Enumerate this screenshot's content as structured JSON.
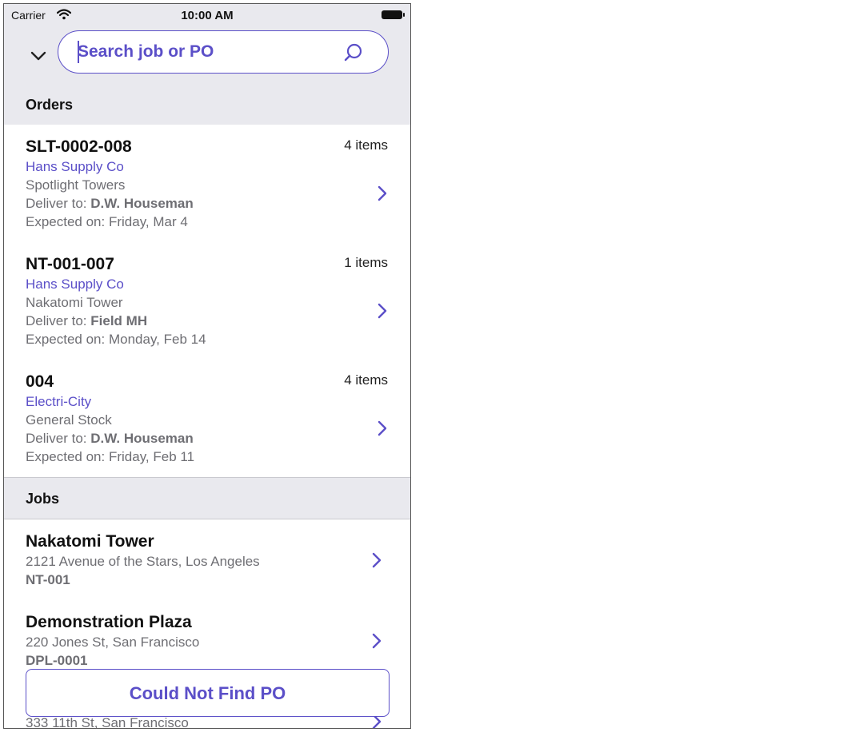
{
  "status_bar": {
    "carrier": "Carrier",
    "time": "10:00 AM"
  },
  "search": {
    "placeholder": "Search job or PO"
  },
  "sections": {
    "orders": "Orders",
    "jobs": "Jobs"
  },
  "orders": [
    {
      "po": "SLT-0002-008",
      "count": "4 items",
      "supplier": "Hans Supply Co",
      "place": "Spotlight Towers",
      "deliver_label": "Deliver to:",
      "deliver_to": "D.W. Houseman",
      "expected": "Expected on: Friday, Mar 4"
    },
    {
      "po": "NT-001-007",
      "count": "1 items",
      "supplier": "Hans Supply Co",
      "place": "Nakatomi Tower",
      "deliver_label": "Deliver to:",
      "deliver_to": "Field MH",
      "expected": "Expected on: Monday, Feb 14"
    },
    {
      "po": "004",
      "count": "4 items",
      "supplier": "Electri-City",
      "place": "General Stock",
      "deliver_label": "Deliver to:",
      "deliver_to": "D.W. Houseman",
      "expected": "Expected on: Friday, Feb 11"
    }
  ],
  "jobs": [
    {
      "name": "Nakatomi Tower",
      "address": "2121 Avenue of the Stars, Los Angeles",
      "code": "NT-001"
    },
    {
      "name": "Demonstration Plaza",
      "address": "220 Jones St, San Francisco",
      "code": "DPL-0001"
    },
    {
      "name": "",
      "address": "333 11th St, San Francisco",
      "code": ""
    }
  ],
  "could_not_find": "Could Not Find PO",
  "colors": {
    "accent": "#5b4fc8",
    "secondary_text": "#6e6e73",
    "header_bg": "#e9e9ee"
  },
  "icons": [
    "wifi-icon",
    "battery-icon",
    "chevron-down-icon",
    "search-icon",
    "chevron-right-icon"
  ]
}
